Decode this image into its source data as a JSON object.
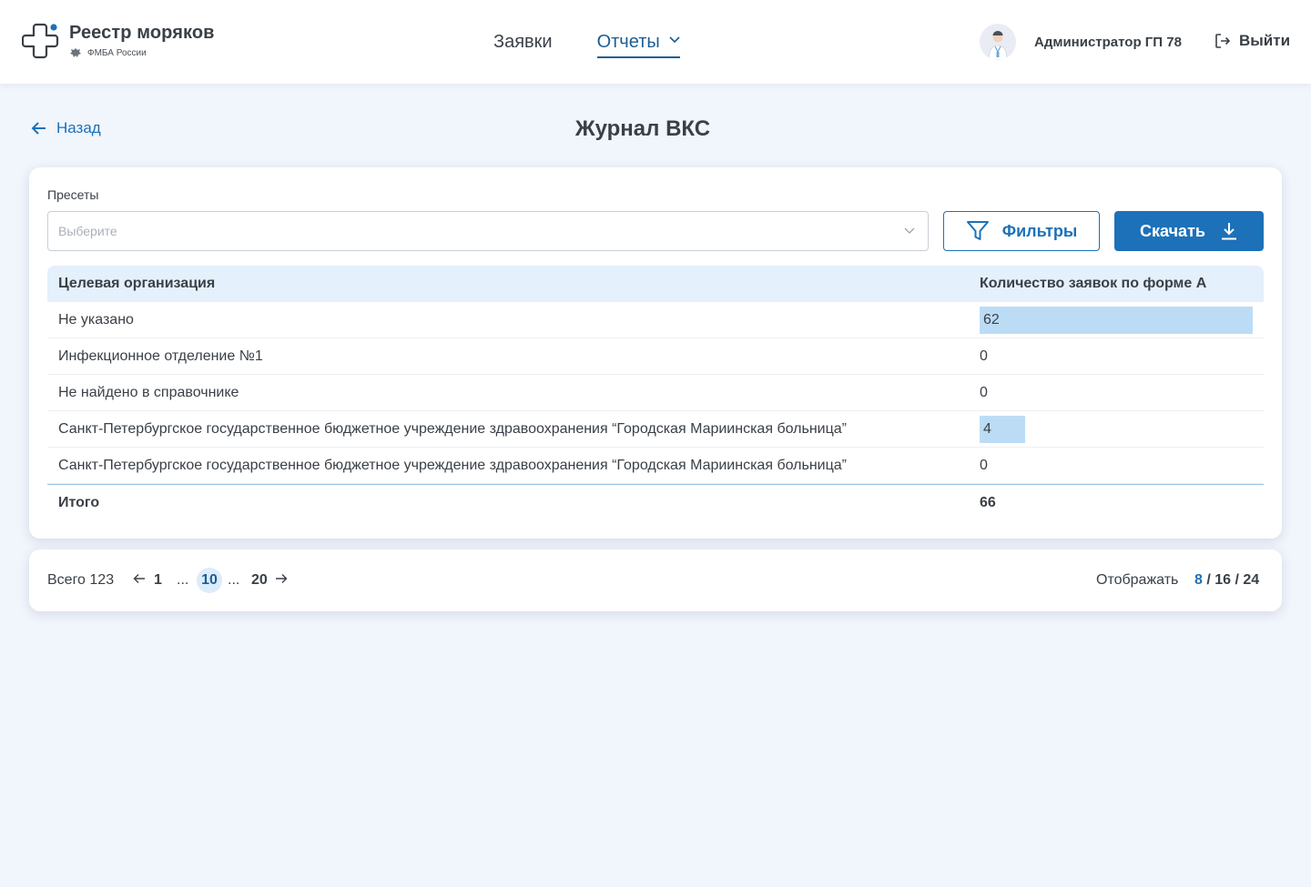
{
  "header": {
    "logo_title": "Реестр моряков",
    "logo_subtitle": "ФМБА России",
    "nav": [
      {
        "label": "Заявки",
        "active": false
      },
      {
        "label": "Отчеты",
        "active": true
      }
    ],
    "user_name": "Администратор ГП 78",
    "logout_label": "Выйти"
  },
  "page": {
    "back_label": "Назад",
    "title": "Журнал ВКС"
  },
  "filters": {
    "presets_label": "Пресеты",
    "presets_placeholder": "Выберите",
    "filters_button": "Фильтры",
    "download_button": "Скачать"
  },
  "table": {
    "columns": [
      "Целевая организация",
      "Количество заявок по форме А"
    ],
    "rows": [
      {
        "org": "Не указано",
        "count": "62",
        "bar": 1.0
      },
      {
        "org": "Инфекционное отделение №1",
        "count": "0",
        "bar": 0
      },
      {
        "org": "Не найдено в справочнике",
        "count": "0",
        "bar": 0
      },
      {
        "org": "Санкт-Петербургское государственное бюджетное учреждение здравоохранения “Городская Мариинская больница”",
        "count": "4",
        "bar": 0.167
      },
      {
        "org": "Санкт-Петербургское государственное бюджетное учреждение здравоохранения “Городская Мариинская больница”",
        "count": "0",
        "bar": 0
      }
    ],
    "total_label": "Итого",
    "total_value": "66"
  },
  "pagination": {
    "total_label": "Всего 123",
    "first": "1",
    "ellipsis": "...",
    "current": "10",
    "last": "20",
    "show_label": "Отображать",
    "sizes": [
      "8",
      "16",
      "24"
    ],
    "separator": "/"
  },
  "colors": {
    "accent": "#1d71b8",
    "accent_dark": "#1d5d93",
    "bar": "#bcdcf6",
    "header_row": "#e4f0fb",
    "background": "#f1f5fc"
  }
}
